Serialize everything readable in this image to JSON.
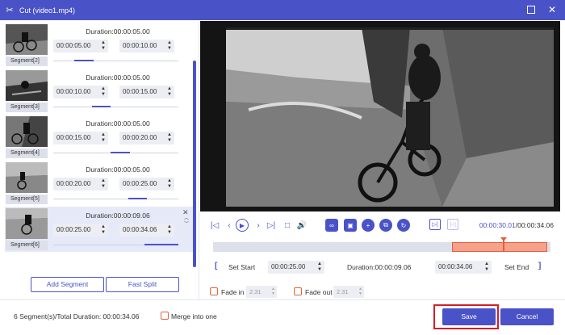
{
  "window": {
    "title": "Cut (video1.mp4)"
  },
  "segments": [
    {
      "label": "Segment[2]",
      "duration": "Duration:00:00:05.00",
      "start": "00:00:05.00",
      "end": "00:00:10.00",
      "fill_start": 0.17,
      "fill_end": 0.32
    },
    {
      "label": "Segment[3]",
      "duration": "Duration:00:00:05.00",
      "start": "00:00:10.00",
      "end": "00:00:15.00",
      "fill_start": 0.31,
      "fill_end": 0.46
    },
    {
      "label": "Segment[4]",
      "duration": "Duration:00:00:05.00",
      "start": "00:00:15.00",
      "end": "00:00:20.00",
      "fill_start": 0.46,
      "fill_end": 0.61
    },
    {
      "label": "Segment[5]",
      "duration": "Duration:00:00:05.00",
      "start": "00:00:20.00",
      "end": "00:00:25.00",
      "fill_start": 0.6,
      "fill_end": 0.75
    },
    {
      "label": "Segment[6]",
      "duration": "Duration:00:00:09.06",
      "start": "00:00:25.00",
      "end": "00:00:34.06",
      "fill_start": 0.73,
      "fill_end": 1.0
    }
  ],
  "buttons": {
    "add_segment": "Add Segment",
    "fast_split": "Fast Split",
    "set_start": "Set Start",
    "set_end": "Set End",
    "save": "Save",
    "cancel": "Cancel"
  },
  "playback": {
    "current": "00:00:30.01",
    "total": "/00:00:34.06"
  },
  "cut": {
    "start": "00:00:25.00",
    "duration": "Duration:00:00:09.06",
    "end": "00:00:34.06"
  },
  "fade": {
    "fade_in_label": "Fade in",
    "fade_in_value": "2.31",
    "fade_out_label": "Fade out",
    "fade_out_value": "2.31"
  },
  "footer": {
    "total": "6 Segment(s)/Total Duration: 00:00:34.06",
    "merge": "Merge into one"
  },
  "colors": {
    "accent": "#4a52c8",
    "highlight": "#d61b2a",
    "selection": "#f5a28c"
  }
}
